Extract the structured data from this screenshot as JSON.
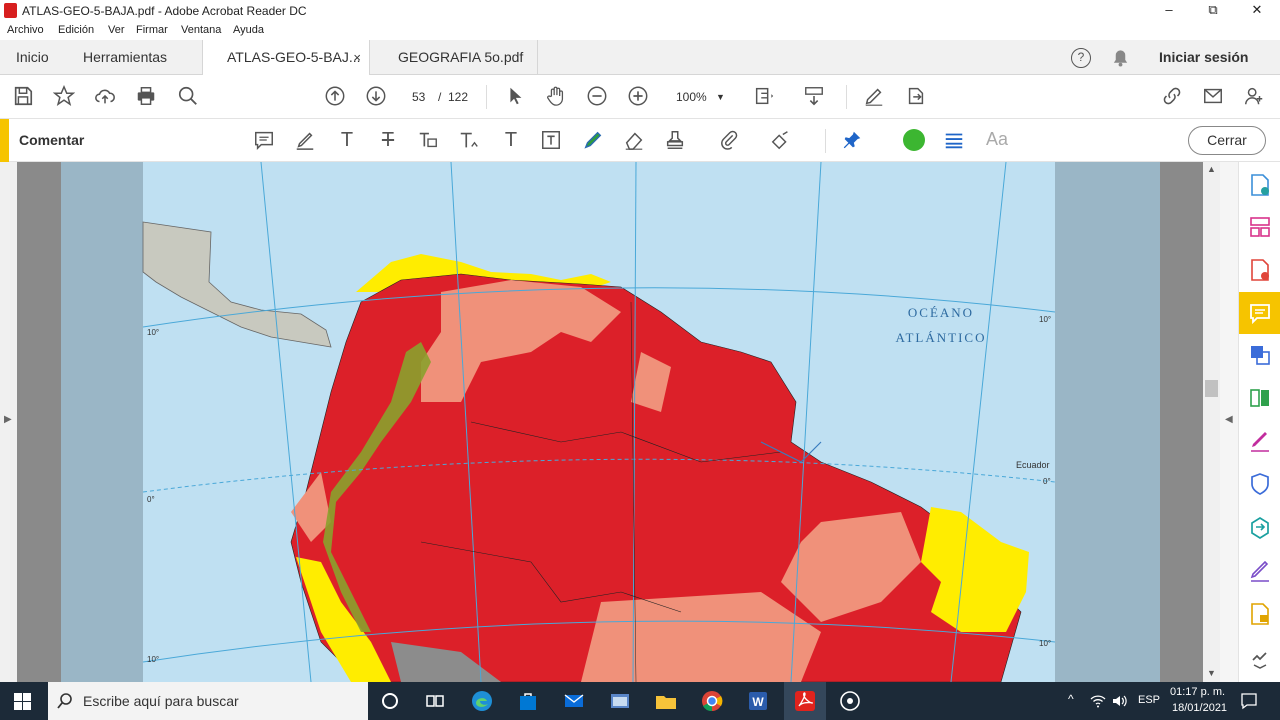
{
  "window": {
    "title": "ATLAS-GEO-5-BAJA.pdf - Adobe Acrobat Reader DC",
    "minimize": "–",
    "maximize": "⧉",
    "close": "✕"
  },
  "menu": [
    "Archivo",
    "Edición",
    "Ver",
    "Firmar",
    "Ventana",
    "Ayuda"
  ],
  "tabs": {
    "home": "Inicio",
    "tools": "Herramientas",
    "docs": [
      {
        "label": "ATLAS-GEO-5-BAJ...",
        "active": true,
        "close": "×"
      },
      {
        "label": "GEOGRAFIA 5o.pdf",
        "active": false
      }
    ],
    "signin": "Iniciar sesión"
  },
  "toolbar": {
    "page_current": "53",
    "page_separator": "/",
    "page_total": "122",
    "zoom": "100%"
  },
  "comment_bar": {
    "label": "Comentar",
    "close_label": "Cerrar",
    "color_accent": "#f6c400",
    "fill_color": "#3cb631",
    "text_tool": "Aa"
  },
  "map": {
    "ocean_label_1": "OCÉANO",
    "ocean_label_2": "ATLÁNTICO",
    "equator_label": "Ecuador",
    "deg_labels": [
      "10°",
      "10°",
      "0°",
      "0°",
      "10°",
      "10°"
    ]
  },
  "taskbar": {
    "search_placeholder": "Escribe aquí para buscar",
    "lang": "ESP",
    "time": "01:17 p. m.",
    "date": "18/01/2021"
  }
}
